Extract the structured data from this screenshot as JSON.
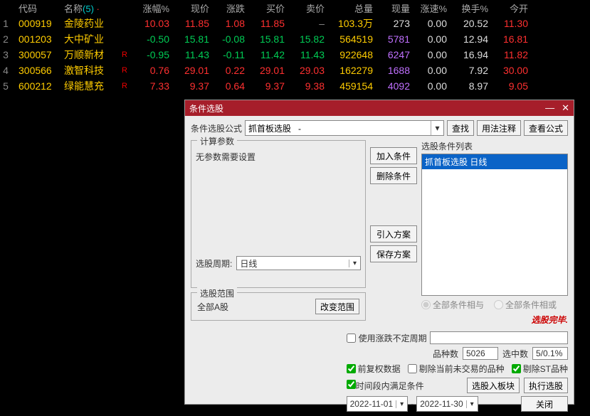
{
  "table": {
    "headers": {
      "code": "代码",
      "name": "名称",
      "name_count": "(5)",
      "pct": "涨幅%",
      "price": "现价",
      "chg": "涨跌",
      "bid": "买价",
      "ask": "卖价",
      "vol": "总量",
      "cur": "现量",
      "spd": "涨速%",
      "turn": "换手%",
      "open": "今开"
    },
    "rows": [
      {
        "idx": "1",
        "code": "000919",
        "name": "金陵药业",
        "tag": "",
        "pct": "10.03",
        "price": "11.85",
        "chg": "1.08",
        "bid": "11.85",
        "ask": "–",
        "vol": "103.3万",
        "cur": "273",
        "spd": "0.00",
        "turn": "20.52",
        "open": "11.30",
        "c": {
          "code": "yellow",
          "name": "yellow",
          "pct": "red",
          "price": "red",
          "chg": "red",
          "bid": "red",
          "ask": "gray",
          "vol": "yellow",
          "cur": "white",
          "spd": "white",
          "turn": "white",
          "open": "red"
        }
      },
      {
        "idx": "2",
        "code": "001203",
        "name": "大中矿业",
        "tag": "",
        "pct": "-0.50",
        "price": "15.81",
        "chg": "-0.08",
        "bid": "15.81",
        "ask": "15.82",
        "vol": "564519",
        "cur": "5781",
        "spd": "0.00",
        "turn": "12.94",
        "open": "16.81",
        "c": {
          "code": "yellow",
          "name": "yellow",
          "pct": "green",
          "price": "green",
          "chg": "green",
          "bid": "green",
          "ask": "green",
          "vol": "yellow",
          "cur": "purple",
          "spd": "white",
          "turn": "white",
          "open": "red"
        }
      },
      {
        "idx": "3",
        "code": "300057",
        "name": "万顺新材",
        "tag": "R",
        "pct": "-0.95",
        "price": "11.43",
        "chg": "-0.11",
        "bid": "11.42",
        "ask": "11.43",
        "vol": "922648",
        "cur": "6247",
        "spd": "0.00",
        "turn": "16.94",
        "open": "11.82",
        "c": {
          "code": "yellow",
          "name": "yellow",
          "pct": "green",
          "price": "green",
          "chg": "green",
          "bid": "green",
          "ask": "green",
          "vol": "yellow",
          "cur": "purple",
          "spd": "white",
          "turn": "white",
          "open": "red"
        }
      },
      {
        "idx": "4",
        "code": "300566",
        "name": "激智科技",
        "tag": "R",
        "pct": "0.76",
        "price": "29.01",
        "chg": "0.22",
        "bid": "29.01",
        "ask": "29.03",
        "vol": "162279",
        "cur": "1688",
        "spd": "0.00",
        "turn": "7.92",
        "open": "30.00",
        "c": {
          "code": "yellow",
          "name": "yellow",
          "pct": "red",
          "price": "red",
          "chg": "red",
          "bid": "red",
          "ask": "red",
          "vol": "yellow",
          "cur": "purple",
          "spd": "white",
          "turn": "white",
          "open": "red"
        }
      },
      {
        "idx": "5",
        "code": "600212",
        "name": "绿能慧充",
        "tag": "R",
        "pct": "7.33",
        "price": "9.37",
        "chg": "0.64",
        "bid": "9.37",
        "ask": "9.38",
        "vol": "459154",
        "cur": "4092",
        "spd": "0.00",
        "turn": "8.97",
        "open": "9.05",
        "c": {
          "code": "yellow",
          "name": "yellow",
          "pct": "red",
          "price": "red",
          "chg": "red",
          "bid": "red",
          "ask": "red",
          "vol": "yellow",
          "cur": "purple",
          "spd": "white",
          "turn": "white",
          "open": "red"
        }
      }
    ]
  },
  "dialog": {
    "title": "条件选股",
    "formula_label": "条件选股公式",
    "formula_value": "抓首板选股   -",
    "find": "查找",
    "usage": "用法注释",
    "view_formula": "查看公式",
    "param_legend": "计算参数",
    "param_text": "无参数需要设置",
    "period_label": "选股周期:",
    "period_value": "日线",
    "scope_legend": "选股范围",
    "scope_value": "全部A股",
    "change_scope": "改变范围",
    "add_cond": "加入条件",
    "del_cond": "删除条件",
    "import_plan": "引入方案",
    "save_plan": "保存方案",
    "list_label": "选股条件列表",
    "list_item": "抓首板选股  日线",
    "radio_and": "全部条件相与",
    "radio_or": "全部条件相或",
    "status": "选股完毕.",
    "use_var_period": "使用涨跌不定周期",
    "stats_count_label": "品种数",
    "stats_count": "5026",
    "stats_sel_label": "选中数",
    "stats_sel": "5/0.1%",
    "opt_fq": "前复权数据",
    "opt_rm_notrade": "剔除当前未交易的品种",
    "opt_rm_st": "剔除ST品种",
    "opt_time": "时间段内满足条件",
    "to_sector": "选股入板块",
    "run": "执行选股",
    "date_from": "2022-11-01",
    "date_sep": "-",
    "date_to": "2022-11-30",
    "close": "关闭"
  }
}
